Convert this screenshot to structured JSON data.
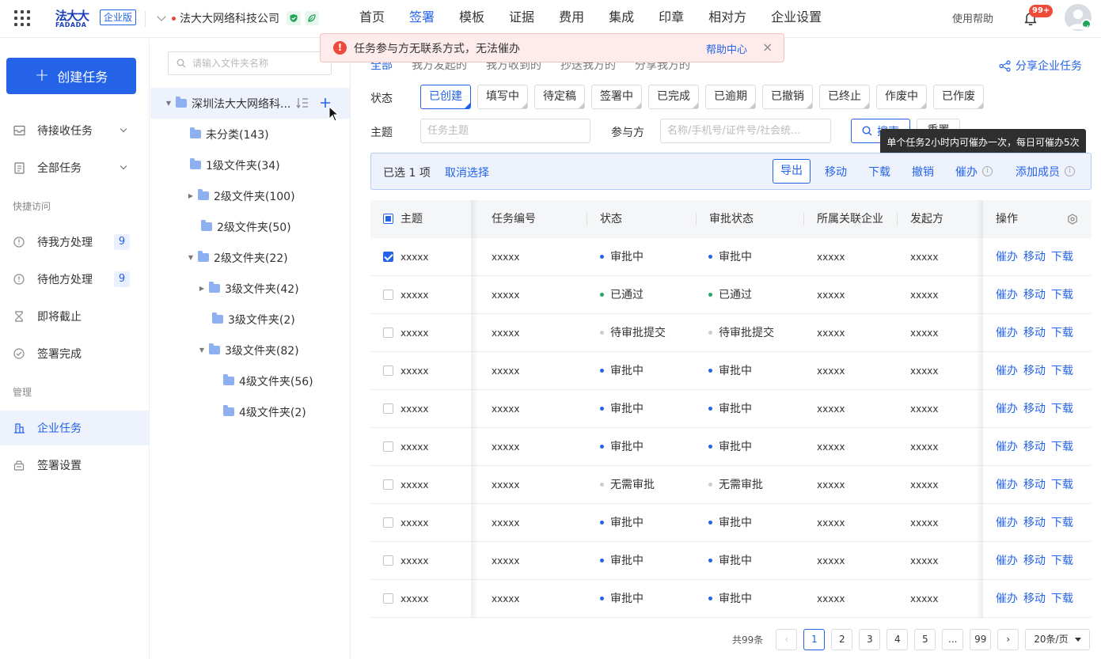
{
  "topbar": {
    "logo_cn": "法大大",
    "logo_en": "FADADA",
    "edition": "企业版",
    "company": "法大大网络科技公司",
    "nav": [
      "首页",
      "签署",
      "模板",
      "证据",
      "费用",
      "集成",
      "印章",
      "相对方",
      "企业设置"
    ],
    "active_nav": "签署",
    "help": "使用帮助",
    "notification_count": "99+"
  },
  "sidebar": {
    "create_label": "创建任务",
    "items": [
      {
        "label": "待接收任务",
        "icon": "inbox-icon",
        "expandable": true
      },
      {
        "label": "全部任务",
        "icon": "document-icon",
        "expandable": true
      }
    ],
    "quick_section": "快捷访问",
    "quick_items": [
      {
        "label": "待我方处理",
        "icon": "clock-icon",
        "count": "9"
      },
      {
        "label": "待他方处理",
        "icon": "clock-icon",
        "count": "9"
      },
      {
        "label": "即将截止",
        "icon": "hourglass-icon"
      },
      {
        "label": "签署完成",
        "icon": "check-circle-icon"
      }
    ],
    "manage_section": "管理",
    "manage_items": [
      {
        "label": "企业任务",
        "icon": "building-icon",
        "active": true
      },
      {
        "label": "签署设置",
        "icon": "settings-lock-icon"
      }
    ]
  },
  "tree": {
    "search_placeholder": "请输入文件夹名称",
    "nodes": [
      {
        "label": "深圳法大大网络科...",
        "level": 0,
        "toggle": "open",
        "selected": true
      },
      {
        "label": "未分类(143)",
        "level": 1,
        "toggle": "none"
      },
      {
        "label": "1级文件夹(34)",
        "level": 1,
        "toggle": "none"
      },
      {
        "label": "2级文件夹(100)",
        "level": 2,
        "toggle": "closed"
      },
      {
        "label": "2级文件夹(50)",
        "level": 2,
        "toggle": "none"
      },
      {
        "label": "2级文件夹(22)",
        "level": 2,
        "toggle": "open"
      },
      {
        "label": "3级文件夹(42)",
        "level": 3,
        "toggle": "closed"
      },
      {
        "label": "3级文件夹(2)",
        "level": 3,
        "toggle": "none"
      },
      {
        "label": "3级文件夹(82)",
        "level": 3,
        "toggle": "open"
      },
      {
        "label": "4级文件夹(56)",
        "level": 4,
        "toggle": "none"
      },
      {
        "label": "4级文件夹(2)",
        "level": 4,
        "toggle": "none"
      }
    ]
  },
  "toast": {
    "message": "任务参与方无联系方式，无法催办",
    "link": "帮助中心",
    "close": "×"
  },
  "main": {
    "tabs": [
      "全部",
      "我方发起的",
      "我方收到的",
      "抄送我方的",
      "分享我方的"
    ],
    "active_tab": "全部",
    "share_label": "分享企业任务",
    "status_label": "状态",
    "statuses": [
      "已创建",
      "填写中",
      "待定稿",
      "签署中",
      "已完成",
      "已逾期",
      "已撤销",
      "已终止",
      "作废中",
      "已作废"
    ],
    "active_status": "已创建",
    "subject_label": "主题",
    "subject_placeholder": "任务主题",
    "party_label": "参与方",
    "party_placeholder": "名称/手机号/证件号/社会统...",
    "search_label": "搜索",
    "reset_label": "重置",
    "tooltip": "单个任务2小时内可催办一次，每日可催办5次"
  },
  "selection": {
    "selected_prefix": "已选",
    "selected_count": "1",
    "selected_suffix": "项",
    "cancel": "取消选择",
    "actions": [
      "导出",
      "移动",
      "下载",
      "撤销",
      "催办",
      "添加成员"
    ]
  },
  "table": {
    "columns": [
      "主题",
      "任务编号",
      "状态",
      "审批状态",
      "所属关联企业",
      "发起方",
      "操作"
    ],
    "rows": [
      {
        "subject": "xxxxx",
        "id": "xxxxx",
        "status": "审批中",
        "approval": "审批中",
        "company": "xxxxx",
        "initiator": "xxxxx",
        "checked": true
      },
      {
        "subject": "xxxxx",
        "id": "xxxxx",
        "status": "已通过",
        "approval": "已通过",
        "company": "xxxxx",
        "initiator": "xxxxx",
        "checked": false
      },
      {
        "subject": "xxxxx",
        "id": "xxxxx",
        "status": "待审批提交",
        "approval": "待审批提交",
        "company": "xxxxx",
        "initiator": "xxxxx",
        "checked": false
      },
      {
        "subject": "xxxxx",
        "id": "xxxxx",
        "status": "审批中",
        "approval": "审批中",
        "company": "xxxxx",
        "initiator": "xxxxx",
        "checked": false
      },
      {
        "subject": "xxxxx",
        "id": "xxxxx",
        "status": "审批中",
        "approval": "审批中",
        "company": "xxxxx",
        "initiator": "xxxxx",
        "checked": false
      },
      {
        "subject": "xxxxx",
        "id": "xxxxx",
        "status": "审批中",
        "approval": "审批中",
        "company": "xxxxx",
        "initiator": "xxxxx",
        "checked": false
      },
      {
        "subject": "xxxxx",
        "id": "xxxxx",
        "status": "无需审批",
        "approval": "无需审批",
        "company": "xxxxx",
        "initiator": "xxxxx",
        "checked": false
      },
      {
        "subject": "xxxxx",
        "id": "xxxxx",
        "status": "审批中",
        "approval": "审批中",
        "company": "xxxxx",
        "initiator": "xxxxx",
        "checked": false
      },
      {
        "subject": "xxxxx",
        "id": "xxxxx",
        "status": "审批中",
        "approval": "审批中",
        "company": "xxxxx",
        "initiator": "xxxxx",
        "checked": false
      },
      {
        "subject": "xxxxx",
        "id": "xxxxx",
        "status": "审批中",
        "approval": "审批中",
        "company": "xxxxx",
        "initiator": "xxxxx",
        "checked": false
      }
    ],
    "row_actions": [
      "催办",
      "移动",
      "下载"
    ],
    "status_colors": {
      "审批中": "#2463e8",
      "已通过": "#27a567",
      "待审批提交": "#cccccc",
      "无需审批": "#cccccc"
    }
  },
  "pagination": {
    "total": "共99条",
    "pages": [
      "1",
      "2",
      "3",
      "4",
      "5",
      "...",
      "99"
    ],
    "active_page": "1",
    "page_size": "20条/页"
  },
  "colors": {
    "primary": "#2463e8",
    "danger": "#ec4a3d",
    "success": "#27a567"
  }
}
